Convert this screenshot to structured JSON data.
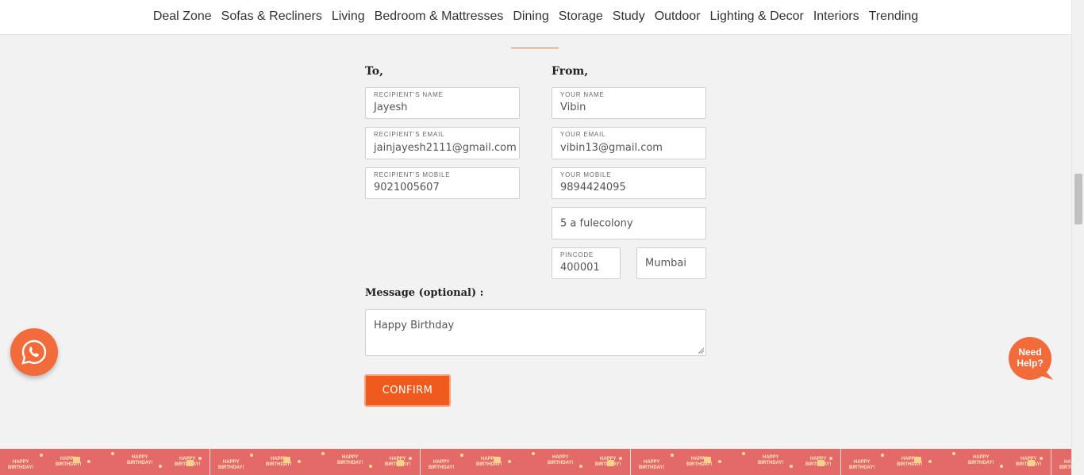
{
  "nav": {
    "items": [
      "Deal Zone",
      "Sofas & Recliners",
      "Living",
      "Bedroom & Mattresses",
      "Dining",
      "Storage",
      "Study",
      "Outdoor",
      "Lighting & Decor",
      "Interiors",
      "Trending"
    ]
  },
  "form": {
    "to_title": "To,",
    "from_title": "From,",
    "recipient_name": {
      "label": "RECIPIENT'S NAME",
      "value": "Jayesh"
    },
    "recipient_email": {
      "label": "RECIPIENT'S EMAIL",
      "value": "jainjayesh2111@gmail.com"
    },
    "recipient_mobile": {
      "label": "RECIPIENT'S MOBILE",
      "value": "9021005607"
    },
    "your_name": {
      "label": "YOUR NAME",
      "value": "Vibin"
    },
    "your_email": {
      "label": "YOUR EMAIL",
      "value": "vibin13@gmail.com"
    },
    "your_mobile": {
      "label": "YOUR MOBILE",
      "value": "9894424095"
    },
    "address": {
      "value": "5 a fulecolony"
    },
    "pincode": {
      "label": "PINCODE",
      "value": "400001"
    },
    "city": {
      "value": "Mumbai"
    },
    "message_label": "Message (optional) :",
    "message_value": "Happy Birthday",
    "confirm_label": "CONFIRM"
  },
  "help": {
    "text_line1": "Need",
    "text_line2": "Help?"
  },
  "band": {
    "tile_text_1": "HAPPY",
    "tile_text_2": "BIRTHDAY!"
  },
  "colors": {
    "accent": "#f05a1c",
    "whatsapp": "#f26b3a",
    "band": "#e46a6a",
    "background": "#f2f2f2"
  },
  "icons": {
    "whatsapp": "whatsapp-icon",
    "help": "chat-bubble-icon"
  }
}
